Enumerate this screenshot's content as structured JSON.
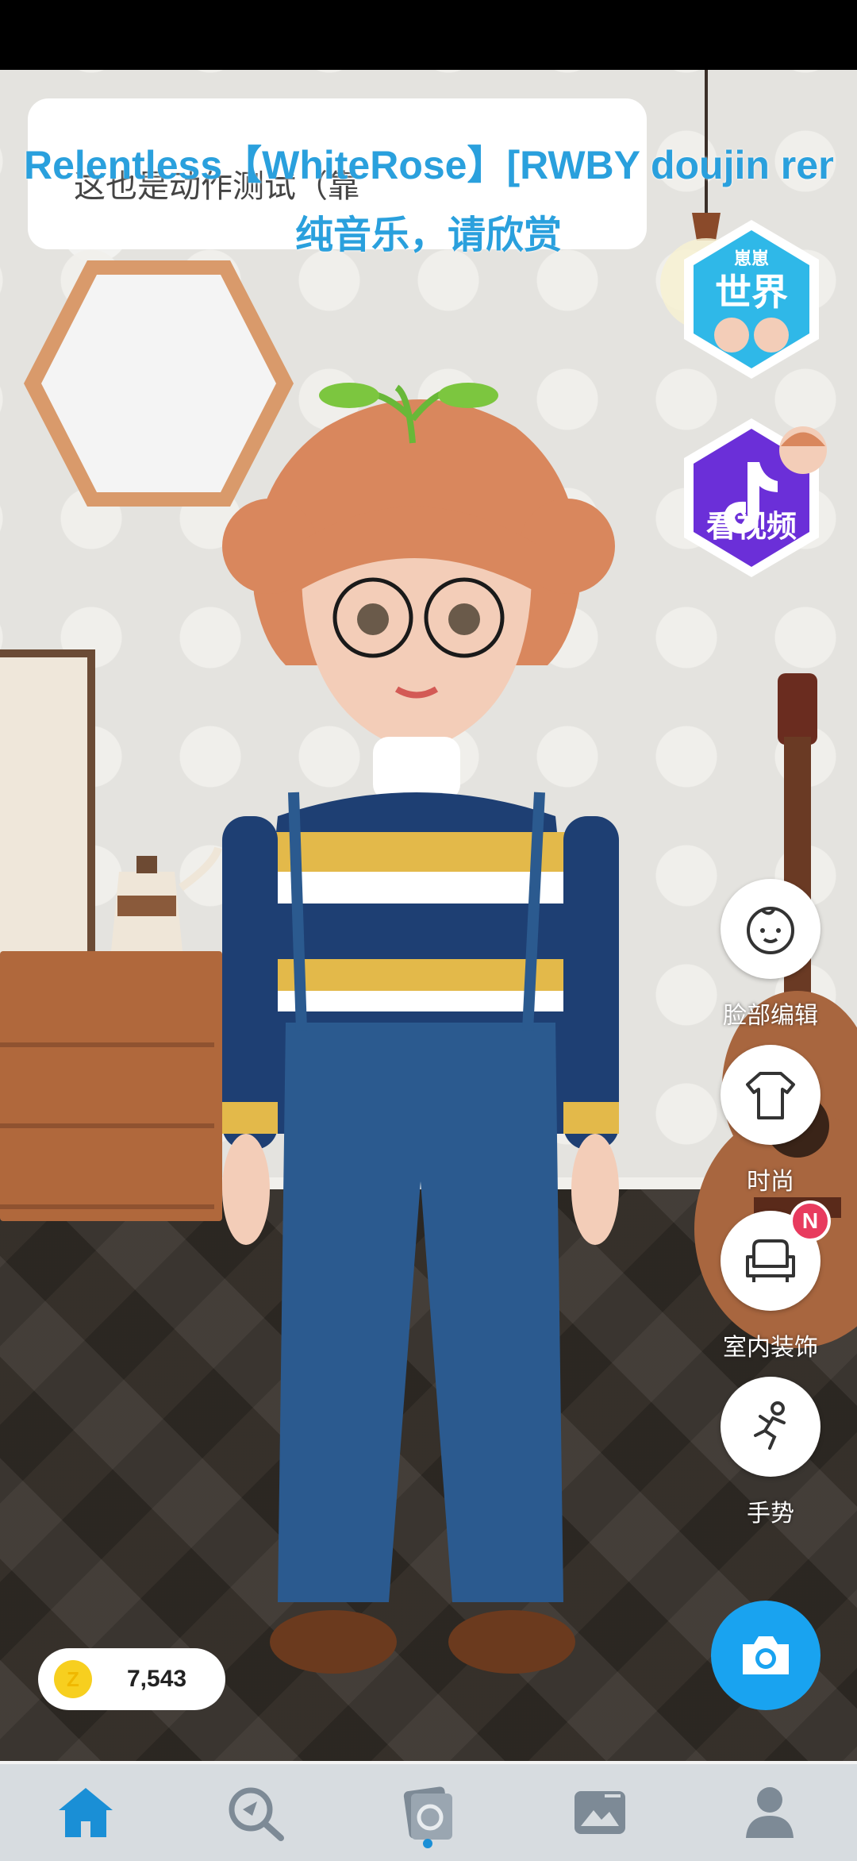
{
  "lyrics": {
    "line1": "Relentless【WhiteRose】[RWBY doujin ren",
    "line2": "纯音乐，请欣赏",
    "underlying_text": "这也是动作测试（靠"
  },
  "badges": {
    "world": {
      "top": "崽崽",
      "main": "世界",
      "icon": "world-badge-icon"
    },
    "video": {
      "main": "看视频",
      "icon": "tiktok-icon"
    }
  },
  "side_menu": [
    {
      "label": "脸部编辑",
      "icon": "face-icon"
    },
    {
      "label": "时尚",
      "icon": "shirt-icon"
    },
    {
      "label": "室内装饰",
      "icon": "sofa-icon"
    },
    {
      "label": "手势",
      "icon": "gesture-icon"
    }
  ],
  "notification_badge": "N",
  "coins": {
    "symbol": "Z",
    "value": "7,543"
  },
  "bottom_nav": [
    {
      "name": "home",
      "icon": "home-icon",
      "active": true
    },
    {
      "name": "explore",
      "icon": "explore-icon",
      "active": false
    },
    {
      "name": "create",
      "icon": "photo-studio-icon",
      "active": false
    },
    {
      "name": "gallery",
      "icon": "gallery-icon",
      "active": false
    },
    {
      "name": "profile",
      "icon": "profile-icon",
      "active": false
    }
  ],
  "colors": {
    "accent": "#19a3f0",
    "lyric": "#2aa0dd",
    "nav_active": "#1a8fd6",
    "nav_inactive": "#7d8a96"
  }
}
